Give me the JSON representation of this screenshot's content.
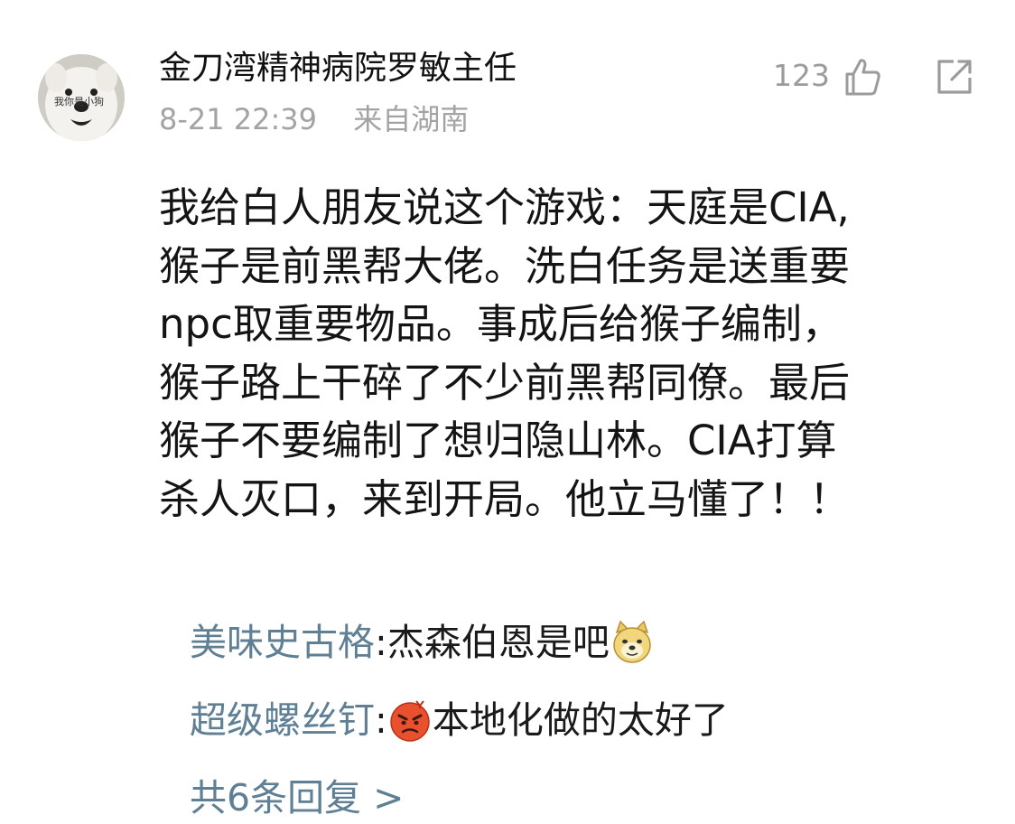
{
  "comment": {
    "author": "金刀湾精神病院罗敏主任",
    "timestamp": "8-21 22:39",
    "location": "来自湖南",
    "like_count": "123",
    "icons": {
      "like": "thumbs-up-icon",
      "share": "share-icon",
      "avatar": "dog-avatar"
    },
    "avatar_text": "我你是小狗",
    "body_lines": [
      "我给白人朋友说这个游戏：天庭是CIA,",
      "猴子是前黑帮大佬。洗白任务是送重要",
      "npc取重要物品。事成后给猴子编制，",
      "猴子路上干碎了不少前黑帮同僚。最后",
      "猴子不要编制了想归隐山林。CIA打算",
      "杀人灭口，来到开局。他立马懂了！！"
    ]
  },
  "replies": [
    {
      "name": "美味史古格",
      "colon": ": ",
      "text": "杰森伯恩是吧",
      "emoji": "doge-emoji"
    },
    {
      "name": "超级螺丝钉",
      "colon": ": ",
      "text": "本地化做的太好了",
      "emoji": "angry-face-emoji"
    }
  ],
  "more_replies": "共6条回复 >",
  "colors": {
    "name_link": "#5f7f94",
    "meta_gray": "#a3a3a3",
    "text": "#141414"
  }
}
